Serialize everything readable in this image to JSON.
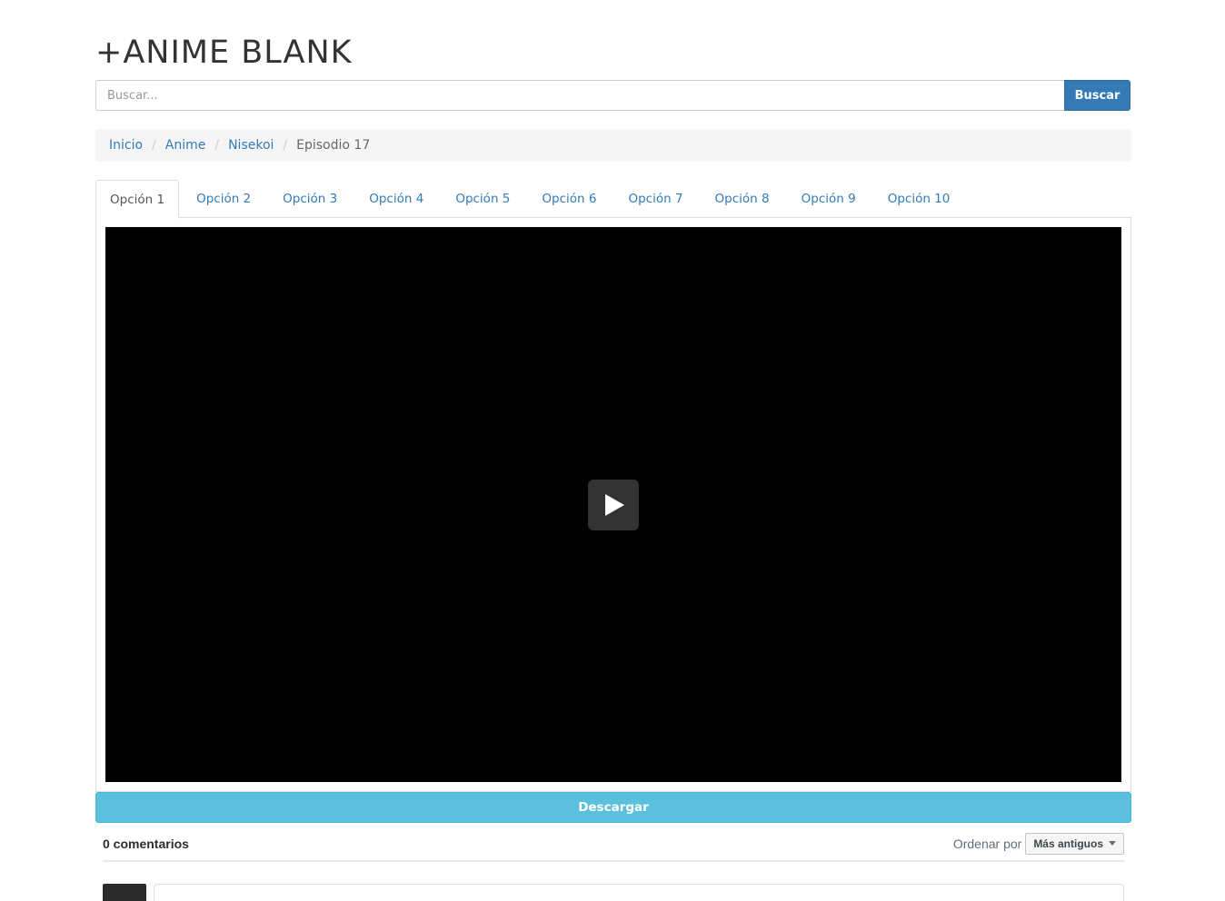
{
  "site": {
    "title": "+ANIME BLANK"
  },
  "search": {
    "placeholder": "Buscar...",
    "button_label": "Buscar"
  },
  "breadcrumb": {
    "items": [
      "Inicio",
      "Anime",
      "Nisekoi"
    ],
    "current": "Episodio 17",
    "separator": "/"
  },
  "tabs": [
    "Opción 1",
    "Opción 2",
    "Opción 3",
    "Opción 4",
    "Opción 5",
    "Opción 6",
    "Opción 7",
    "Opción 8",
    "Opción 9",
    "Opción 10"
  ],
  "active_tab": "Opción 1",
  "player": {
    "icon": "play-icon"
  },
  "download": {
    "label": "Descargar"
  },
  "comments": {
    "count_label": "0 comentarios",
    "sort_label": "Ordenar por",
    "sort_value": "Más antiguos"
  },
  "colors": {
    "primary": "#337ab7",
    "info": "#5bc0de",
    "breadcrumb_bg": "#f5f5f5",
    "video_bg": "#000000"
  }
}
